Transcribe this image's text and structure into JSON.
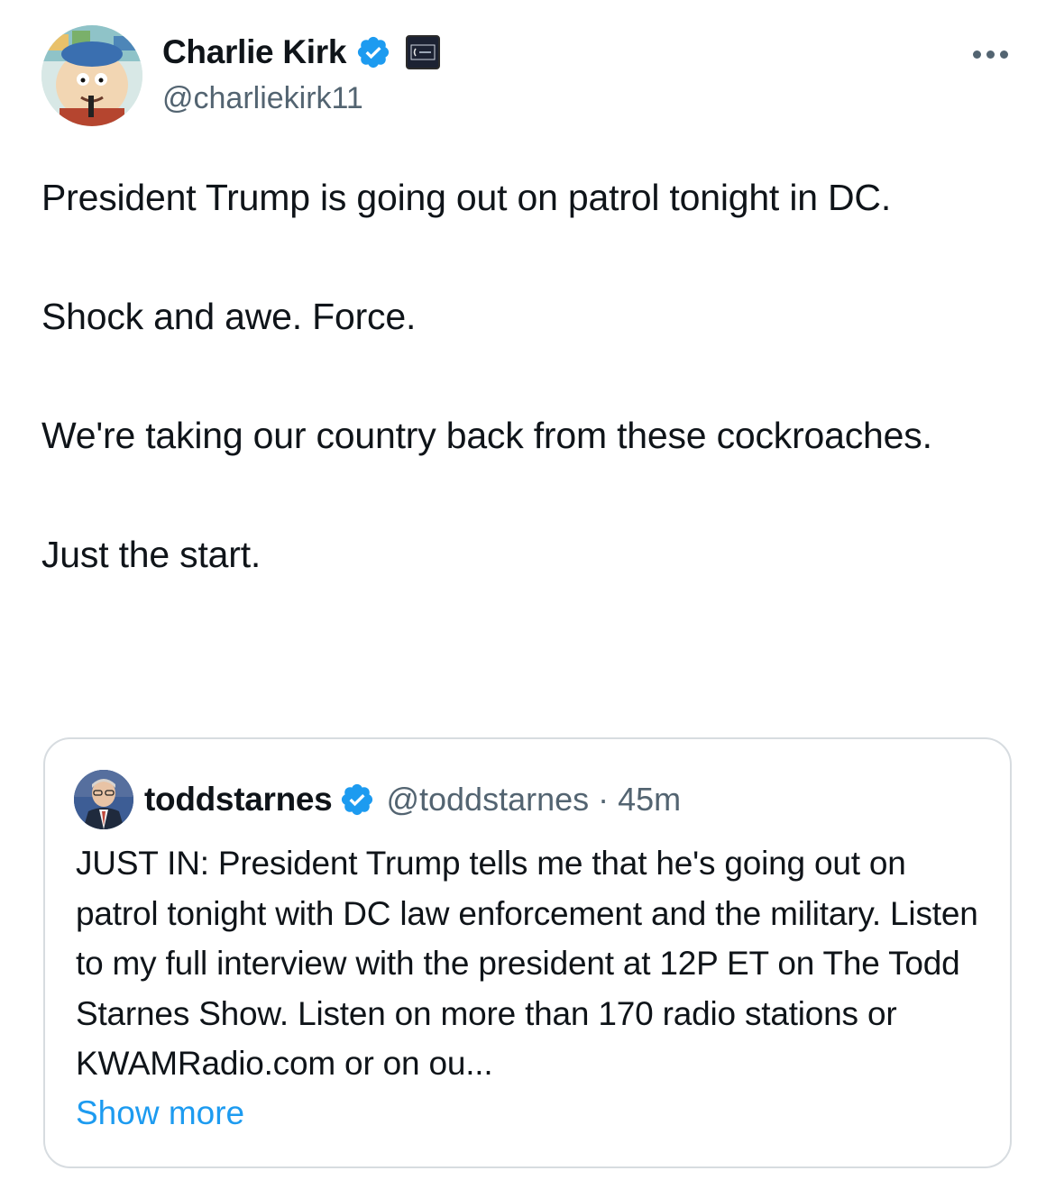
{
  "post": {
    "author": {
      "display_name": "Charlie Kirk",
      "handle": "@charliekirk11",
      "verified": true
    },
    "paragraphs": [
      "President Trump is going out on patrol tonight in DC.",
      "Shock and awe. Force.",
      "We're taking our country back from these cockroaches.",
      "Just the start."
    ]
  },
  "quoted_post": {
    "author": {
      "display_name": "toddstarnes",
      "handle": "@toddstarnes",
      "separator": "·",
      "time": "45m",
      "verified": true
    },
    "text": "JUST IN: President Trump tells me that he's going out on patrol tonight with DC law enforcement and the military. Listen to my full interview with the president at 12P ET on The Todd Starnes Show. Listen on more than 170 radio stations or KWAMRadio.com or on ou...",
    "show_more_label": "Show more"
  },
  "colors": {
    "text_primary": "#0f1419",
    "text_secondary": "#536471",
    "link": "#1d9bf0",
    "verified": "#1d9bf0",
    "card_border": "#d7dce0"
  },
  "icons": {
    "verified": "verified-badge-icon",
    "affiliate": "affiliate-badge-icon",
    "more": "more-options-icon"
  }
}
